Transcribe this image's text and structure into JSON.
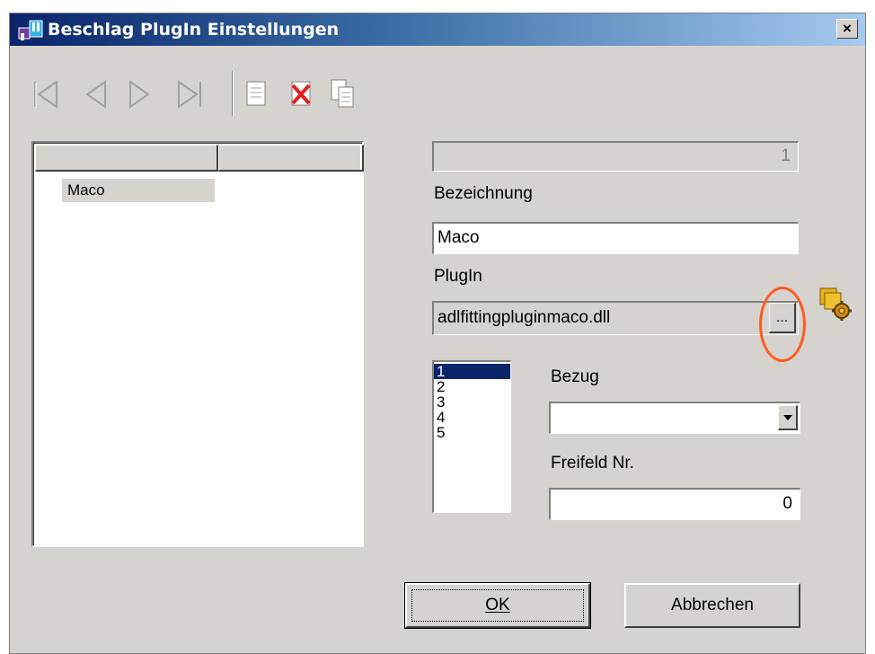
{
  "window": {
    "title": "Beschlag PlugIn Einstellungen",
    "close_label": "×"
  },
  "toolbar": {
    "buttons": [
      {
        "icon": "first-record-icon"
      },
      {
        "icon": "previous-record-icon"
      },
      {
        "icon": "next-record-icon"
      },
      {
        "icon": "last-record-icon"
      },
      {
        "icon": "new-record-icon"
      },
      {
        "icon": "delete-record-icon"
      },
      {
        "icon": "copy-record-icon"
      }
    ]
  },
  "list": {
    "columns": [
      "",
      ""
    ],
    "items": [
      {
        "label": "Maco"
      }
    ]
  },
  "form": {
    "id_value": "1",
    "bezeichnung_label": "Bezeichnung",
    "bezeichnung_value": "Maco",
    "plugin_label": "PlugIn",
    "plugin_value": "adlfittingpluginmaco.dll",
    "browse_label": "...",
    "plugin_settings_icon": "plugin-settings-icon",
    "numbers": [
      "1",
      "2",
      "3",
      "4",
      "5"
    ],
    "selected_number": "1",
    "bezug_label": "Bezug",
    "bezug_value": "",
    "freifeld_label": "Freifeld Nr.",
    "freifeld_value": "0"
  },
  "buttons": {
    "ok_label": "OK",
    "cancel_label": "Abbrechen"
  },
  "colors": {
    "title_start": "#0a246a",
    "title_end": "#a6caf0",
    "dialog_bg": "#d6d3ce",
    "highlight": "#ff5a1f",
    "selection": "#0a246a"
  }
}
